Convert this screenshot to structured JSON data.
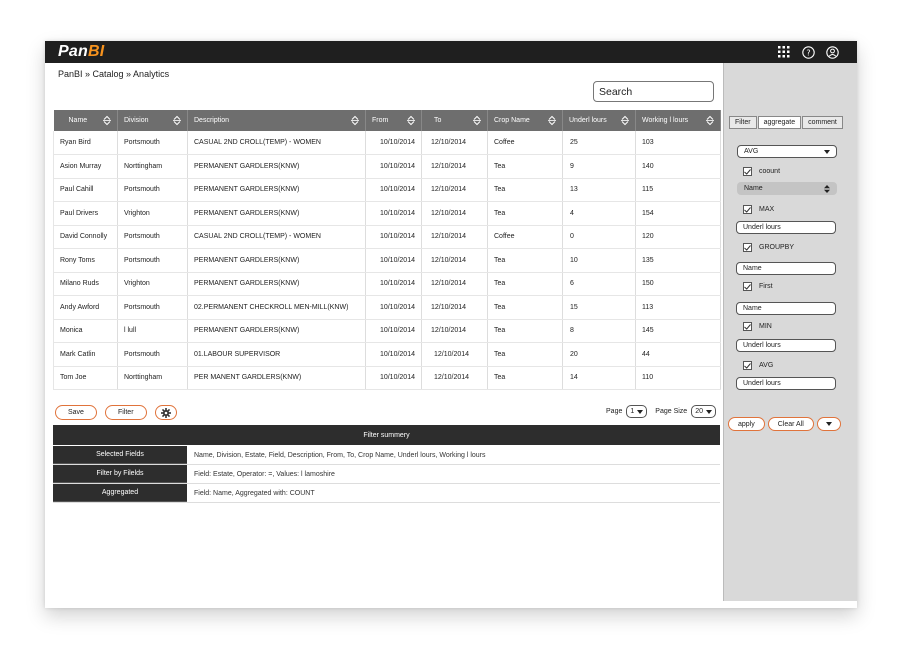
{
  "app": {
    "logo_prefix": "Pan",
    "logo_suffix": "BI",
    "brand_color": "#f7931e",
    "icons": [
      "grid-icon",
      "help-icon",
      "user-icon"
    ]
  },
  "breadcrumb": "PanBI » Catalog » Analytics",
  "search": {
    "value": "Search"
  },
  "table": {
    "columns": [
      "Name",
      "Division",
      "Description",
      "From",
      "To",
      "Crop Name",
      "Underl lours",
      "Working l lours"
    ],
    "rows": [
      [
        "Ryan Bird",
        "Portsmouth",
        "CASUAL 2ND CROLL(TEMP) - WOMEN",
        "10/10/2014",
        "12/10/2014",
        "Coffee",
        "25",
        "103"
      ],
      [
        "Asion Murray",
        "Norttingham",
        "PERMANENT GARDLERS(KNW)",
        "10/10/2014",
        "12/10/2014",
        "Tea",
        "9",
        "140"
      ],
      [
        "Paul Cahill",
        "Portsmouth",
        "PERMANENT GARDLERS(KNW)",
        "10/10/2014",
        "12/10/2014",
        "Tea",
        "13",
        "115"
      ],
      [
        "Paul Drivers",
        "Vrighton",
        "PERMANENT GARDLERS(KNW)",
        "10/10/2014",
        "12/10/2014",
        "Tea",
        "4",
        "154"
      ],
      [
        "David Connolly",
        "Portsmouth",
        "CASUAL 2ND CROLL(TEMP) - WOMEN",
        "10/10/2014",
        "12/10/2014",
        "Coffee",
        "0",
        "120"
      ],
      [
        "Rony Toms",
        "Portsmouth",
        "PERMANENT GARDLERS(KNW)",
        "10/10/2014",
        "12/10/2014",
        "Tea",
        "10",
        "135"
      ],
      [
        "Milano Ruds",
        "Vrighton",
        "PERMANENT GARDLERS(KNW)",
        "10/10/2014",
        "12/10/2014",
        "Tea",
        "6",
        "150"
      ],
      [
        "Andy Awford",
        "Portsmouth",
        "02.PERMANENT CHECKROLL MEN-MILL(KNW)",
        "10/10/2014",
        "12/10/2014",
        "Tea",
        "15",
        "113"
      ],
      [
        "Monica",
        "l lull",
        "PERMANENT GARDLERS(KNW)",
        "10/10/2014",
        "12/10/2014",
        "Tea",
        "8",
        "145"
      ],
      [
        "Mark Catlin",
        "Portsmouth",
        "01.LABOUR SUPERVISOR",
        "10/10/2014",
        "12/10/2014",
        "Tea",
        "20",
        "44"
      ],
      [
        "Tom Joe",
        "Norttingham",
        "PER MANENT GARDLERS(KNW)",
        "10/10/2014",
        "12/10/2014",
        "Tea",
        "14",
        "110"
      ]
    ]
  },
  "actions": {
    "save": "Save",
    "filter": "Filter"
  },
  "pager": {
    "page_label": "Page",
    "page_value": "1",
    "size_label": "Page Size",
    "size_value": "20"
  },
  "summary": {
    "title": "Filter summery",
    "rows": [
      {
        "label": "Selected Fields",
        "value": "Name, Division, Estate, Field, Description, From, To, Crop Name, Underl lours, Working l lours"
      },
      {
        "label": "Filter by Filelds",
        "value": "Field: Estate, Operator: =, Values: l lamoshire"
      },
      {
        "label": "Aggregated",
        "value": "Field: Name,  Aggregated with: COUNT"
      }
    ]
  },
  "panel": {
    "tabs": [
      "Filter",
      "aggregate",
      "comment"
    ],
    "active_tab": "aggregate",
    "avg_select": "AVG",
    "count_label": "coount",
    "name_select": "Name",
    "max_label": "MAX",
    "max_field": "Underl lours",
    "groupby_label": "GROUPBY",
    "groupby_field": "Name",
    "first_label": "First",
    "first_field": "Name",
    "min_label": "MIN",
    "min_field": "Underl lours",
    "avg_label": "AVG",
    "avg_field": "Underl lours",
    "apply": "apply",
    "clear_all": "Clear All"
  },
  "colors": {
    "accent_border": "#e0733b",
    "header_bg": "#6e6e6e",
    "dark_bg": "#2d2d2d",
    "panel_bg": "#d9d9d9"
  }
}
